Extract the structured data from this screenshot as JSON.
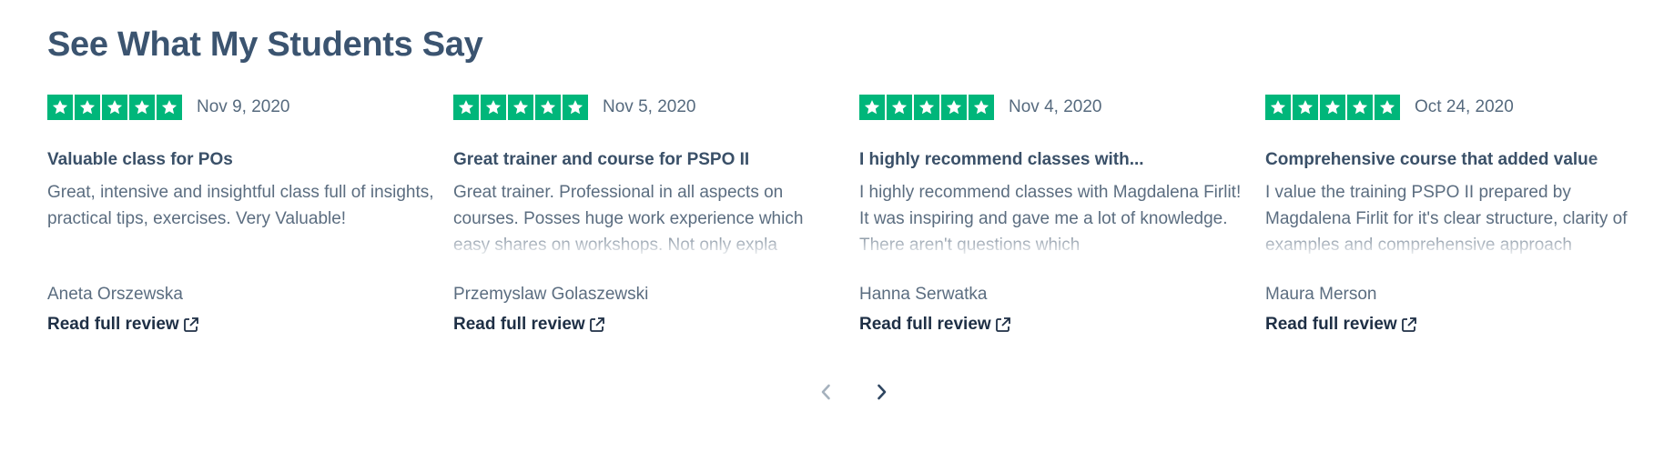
{
  "section": {
    "title": "See What My Students Say"
  },
  "colors": {
    "star_background": "#00b67a",
    "title": "#3b5470",
    "link": "#1e2f45",
    "pager_disabled": "#a5b1bd",
    "pager_enabled": "#3b5470"
  },
  "reviews": [
    {
      "rating": 5,
      "date": "Nov 9, 2020",
      "title": "Valuable class for POs",
      "body": "Great, intensive and insightful class full of insights, practical tips, exercises. Very Valuable!",
      "author": "Aneta Orszewska",
      "link_label": "Read full review",
      "link_icon": "external-link-icon"
    },
    {
      "rating": 5,
      "date": "Nov 5, 2020",
      "title": "Great trainer and course for PSPO II",
      "body": "Great trainer. Professional in all aspects on courses. Posses huge work experience which easy shares on workshops. Not only expla",
      "author": "Przemyslaw Golaszewski",
      "link_label": "Read full review",
      "link_icon": "external-link-icon"
    },
    {
      "rating": 5,
      "date": "Nov 4, 2020",
      "title": "I highly recommend classes with...",
      "body": "I highly recommend classes with Magdalena Firlit! It was inspiring and gave me a lot of knowledge. There aren't questions which",
      "author": "Hanna Serwatka",
      "link_label": "Read full review",
      "link_icon": "external-link-icon"
    },
    {
      "rating": 5,
      "date": "Oct 24, 2020",
      "title": "Comprehensive course that added value",
      "body": "I value the training PSPO II prepared by Magdalena Firlit for it's clear structure, clarity of examples and comprehensive approach",
      "author": "Maura Merson",
      "link_label": "Read full review",
      "link_icon": "external-link-icon"
    }
  ],
  "pager": {
    "prev_icon": "chevron-left-icon",
    "next_icon": "chevron-right-icon",
    "prev_disabled": true
  }
}
